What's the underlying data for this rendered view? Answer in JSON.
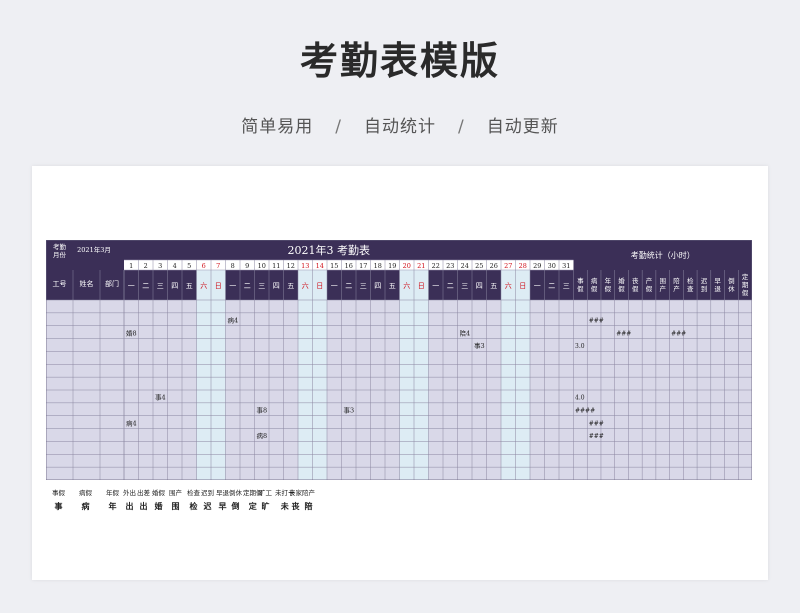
{
  "page": {
    "title": "考勤表模版",
    "subtitle": [
      "简单易用",
      "自动统计",
      "自动更新"
    ],
    "separator": "/"
  },
  "sheet": {
    "month_label": "考勤\n月份",
    "month_value": "2021年3月",
    "title": "2021年3  考勤表",
    "stats_title": "考勤统计（小时）",
    "col_headers": {
      "id": "工号",
      "name": "姓名",
      "dept": "部门"
    },
    "days": [
      {
        "d": "1",
        "w": "一"
      },
      {
        "d": "2",
        "w": "二"
      },
      {
        "d": "3",
        "w": "三"
      },
      {
        "d": "4",
        "w": "四"
      },
      {
        "d": "5",
        "w": "五"
      },
      {
        "d": "6",
        "w": "六",
        "weekend": true
      },
      {
        "d": "7",
        "w": "日",
        "weekend": true
      },
      {
        "d": "8",
        "w": "一"
      },
      {
        "d": "9",
        "w": "二"
      },
      {
        "d": "10",
        "w": "三"
      },
      {
        "d": "11",
        "w": "四"
      },
      {
        "d": "12",
        "w": "五"
      },
      {
        "d": "13",
        "w": "六",
        "weekend": true
      },
      {
        "d": "14",
        "w": "日",
        "weekend": true
      },
      {
        "d": "15",
        "w": "一"
      },
      {
        "d": "16",
        "w": "二"
      },
      {
        "d": "17",
        "w": "三"
      },
      {
        "d": "18",
        "w": "四"
      },
      {
        "d": "19",
        "w": "五"
      },
      {
        "d": "20",
        "w": "六",
        "weekend": true
      },
      {
        "d": "21",
        "w": "日",
        "weekend": true
      },
      {
        "d": "22",
        "w": "一"
      },
      {
        "d": "23",
        "w": "二"
      },
      {
        "d": "24",
        "w": "三"
      },
      {
        "d": "25",
        "w": "四"
      },
      {
        "d": "26",
        "w": "五"
      },
      {
        "d": "27",
        "w": "六",
        "weekend": true
      },
      {
        "d": "28",
        "w": "日",
        "weekend": true
      },
      {
        "d": "29",
        "w": "一"
      },
      {
        "d": "30",
        "w": "二"
      },
      {
        "d": "31",
        "w": "三"
      }
    ],
    "stat_headers": [
      "事假",
      "病假",
      "年假",
      "婚假",
      "丧假",
      "产假",
      "围产",
      "陪产",
      "检查",
      "迟到",
      "早退",
      "倒休",
      "定期假"
    ],
    "cell_marks": [
      {
        "row": 2,
        "day": 1,
        "text": "婚8"
      },
      {
        "row": 1,
        "day": 8,
        "text": "病4"
      },
      {
        "row": 2,
        "day": 24,
        "text": "陪4"
      },
      {
        "row": 3,
        "day": 25,
        "text": "事3"
      },
      {
        "row": 7,
        "day": 3,
        "text": "事4"
      },
      {
        "row": 8,
        "day": 10,
        "text": "事8"
      },
      {
        "row": 8,
        "day": 16,
        "text": "事3"
      },
      {
        "row": 9,
        "day": 1,
        "text": "病4"
      },
      {
        "row": 10,
        "day": 10,
        "text": "病8"
      }
    ],
    "stat_marks": [
      {
        "row": 1,
        "col": 1,
        "text": "###"
      },
      {
        "row": 2,
        "col": 3,
        "text": "###"
      },
      {
        "row": 2,
        "col": 7,
        "text": "###"
      },
      {
        "row": 3,
        "col": 0,
        "text": "3.0"
      },
      {
        "row": 7,
        "col": 0,
        "text": "4.0"
      },
      {
        "row": 8,
        "col": 0,
        "text": "####"
      },
      {
        "row": 9,
        "col": 1,
        "text": "###"
      },
      {
        "row": 10,
        "col": 1,
        "text": "###"
      }
    ],
    "row_count": 14
  },
  "legend": [
    {
      "name": "事假",
      "sym": "事"
    },
    {
      "name": "病假",
      "sym": "病"
    },
    {
      "name": "年假",
      "sym": "年"
    },
    {
      "name": "外出",
      "sym": "出"
    },
    {
      "name": "出差",
      "sym": "出"
    },
    {
      "name": "婚假",
      "sym": "婚"
    },
    {
      "name": "围产",
      "sym": "围"
    },
    {
      "name": "检查",
      "sym": "检"
    },
    {
      "name": "迟到",
      "sym": "迟"
    },
    {
      "name": "早退",
      "sym": "早"
    },
    {
      "name": "倒休",
      "sym": "倒"
    },
    {
      "name": "定期假",
      "sym": "定"
    },
    {
      "name": "旷工",
      "sym": "旷"
    },
    {
      "name": "未打卡",
      "sym": "未"
    },
    {
      "name": "丧家",
      "sym": "丧"
    },
    {
      "name": "陪产",
      "sym": "陪"
    }
  ],
  "colors": {
    "header_bg": "#3b2f57",
    "body_bg": "#d9d8e8",
    "weekend_bg": "#ddecf4",
    "weekend_text": "#d0101a",
    "grid": "#8a86a0"
  }
}
